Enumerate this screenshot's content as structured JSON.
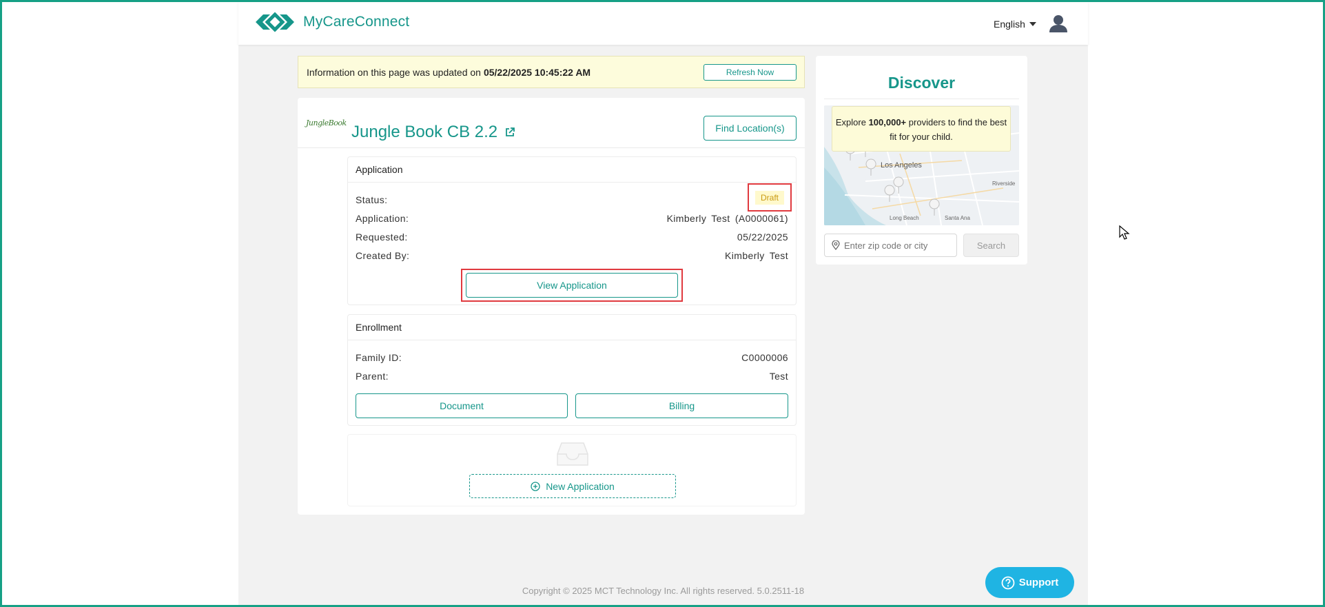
{
  "brand": {
    "name": "MyCareConnect",
    "color": "#16968a"
  },
  "header": {
    "language": "English"
  },
  "banner": {
    "prefix": "Information on this page was updated on",
    "timestamp": "05/22/2025 10:45:22 AM",
    "refresh_label": "Refresh Now"
  },
  "provider": {
    "logo_text": "JungleBook",
    "name": "Jungle Book CB 2.2",
    "find_label": "Find Location(s)"
  },
  "application": {
    "title": "Application",
    "status_label": "Status:",
    "status_value": "Draft",
    "application_label": "Application:",
    "application_value": "Kimberly Test (A0000061)",
    "requested_label": "Requested:",
    "requested_value": "05/22/2025",
    "created_by_label": "Created By:",
    "created_by_value": "Kimberly Test",
    "view_label": "View Application"
  },
  "enrollment": {
    "title": "Enrollment",
    "family_id_label": "Family ID:",
    "family_id_value": "C0000006",
    "parent_label": "Parent:",
    "parent_value": "Test",
    "document_label": "Document",
    "billing_label": "Billing"
  },
  "new_application": {
    "label": "New Application"
  },
  "discover": {
    "title": "Discover",
    "note_prefix": "Explore",
    "note_count": "100,000+",
    "note_suffix": "providers to find the best fit for your child.",
    "map_labels": [
      "Los Angeles",
      "Long Beach",
      "Santa Ana",
      "Riverside"
    ],
    "zip_placeholder": "Enter zip code or city",
    "search_label": "Search"
  },
  "footer": {
    "copyright": "Copyright © 2025 MCT Technology Inc. All rights reserved. 5.0.2511-18"
  },
  "support": {
    "label": "Support"
  },
  "colors": {
    "accent": "#16968a",
    "highlight": "#e0393e",
    "support": "#1fb4e3",
    "draft": "#c99a12"
  }
}
